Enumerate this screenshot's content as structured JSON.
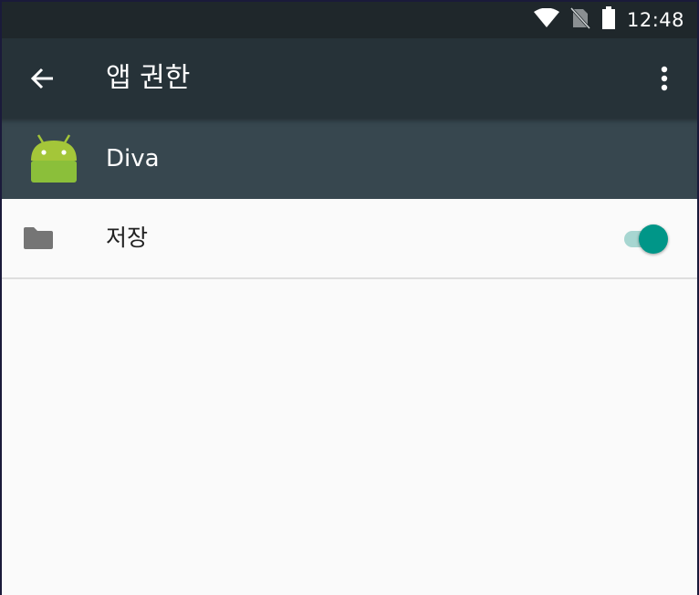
{
  "status_bar": {
    "time": "12:48",
    "icons": [
      "wifi-icon",
      "no-sim-icon",
      "battery-icon"
    ]
  },
  "app_bar": {
    "title": "앱 권한",
    "back_icon": "arrow-back-icon",
    "overflow_icon": "more-vert-icon"
  },
  "app_header": {
    "app_name": "Diva",
    "app_icon": "android-robot-icon"
  },
  "permissions": [
    {
      "label": "저장",
      "icon": "folder-icon",
      "enabled": true
    }
  ],
  "colors": {
    "status_bar": "#1f272b",
    "app_bar": "#263238",
    "app_header": "#37474f",
    "toggle_on": "#009688",
    "background": "#fafafa"
  }
}
